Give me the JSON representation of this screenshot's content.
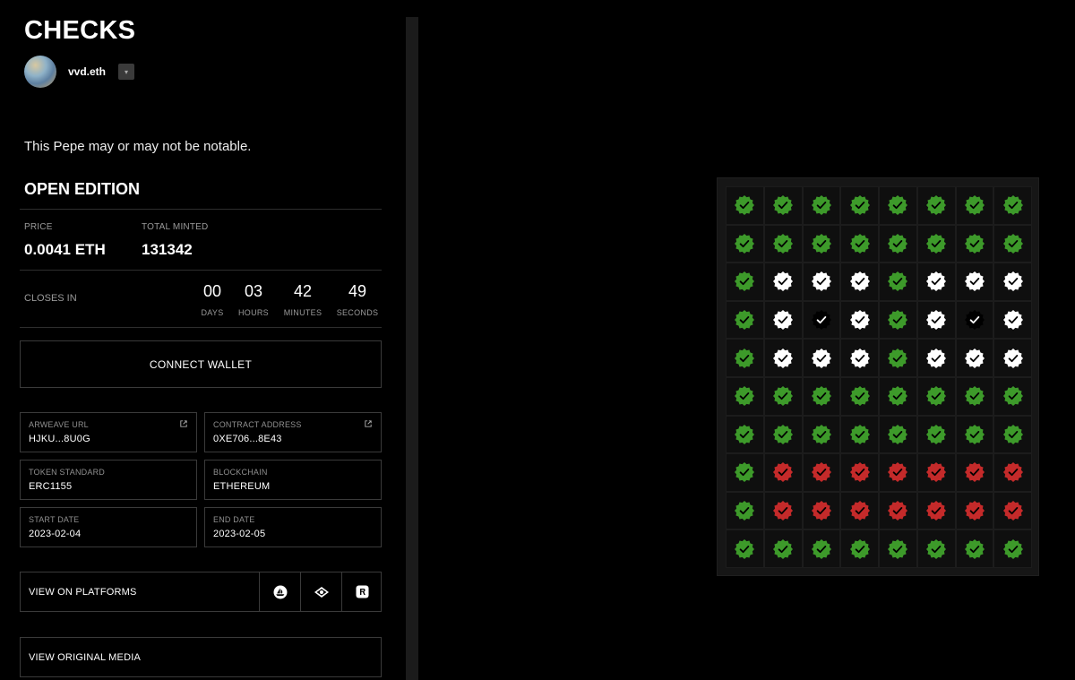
{
  "header": {
    "title": "CHECKS",
    "username": "vvd.eth"
  },
  "description": "This Pepe may or may not be notable.",
  "edition": "OPEN EDITION",
  "stats": {
    "price_label": "PRICE",
    "price_value": "0.0041 ETH",
    "minted_label": "TOTAL MINTED",
    "minted_value": "131342"
  },
  "countdown": {
    "label": "CLOSES IN",
    "units": [
      {
        "value": "00",
        "unit": "DAYS"
      },
      {
        "value": "03",
        "unit": "HOURS"
      },
      {
        "value": "42",
        "unit": "MINUTES"
      },
      {
        "value": "49",
        "unit": "SECONDS"
      }
    ]
  },
  "connect_label": "CONNECT WALLET",
  "details": [
    {
      "label": "ARWEAVE URL",
      "value": "HJKU...8U0G",
      "external": true
    },
    {
      "label": "CONTRACT ADDRESS",
      "value": "0XE706...8E43",
      "external": true
    },
    {
      "label": "TOKEN STANDARD",
      "value": "ERC1155",
      "external": false
    },
    {
      "label": "BLOCKCHAIN",
      "value": "ETHEREUM",
      "external": false
    },
    {
      "label": "START DATE",
      "value": "2023-02-04",
      "external": false
    },
    {
      "label": "END DATE",
      "value": "2023-02-05",
      "external": false
    }
  ],
  "platforms_label": "VIEW ON PLATFORMS",
  "platform_icons": [
    "opensea-icon",
    "eye-icon",
    "rarible-icon"
  ],
  "media_label": "VIEW ORIGINAL MEDIA",
  "colors": {
    "green": "#3d9a2a",
    "white": "#ffffff",
    "black": "#000000",
    "red": "#c42a2a"
  },
  "check_grid": [
    [
      "g",
      "g",
      "g",
      "g",
      "g",
      "g",
      "g",
      "g"
    ],
    [
      "g",
      "g",
      "g",
      "g",
      "g",
      "g",
      "g",
      "g"
    ],
    [
      "g",
      "w",
      "w",
      "w",
      "g",
      "w",
      "w",
      "w"
    ],
    [
      "g",
      "w",
      "b",
      "w",
      "g",
      "w",
      "b",
      "w"
    ],
    [
      "g",
      "w",
      "w",
      "w",
      "g",
      "w",
      "w",
      "w"
    ],
    [
      "g",
      "g",
      "g",
      "g",
      "g",
      "g",
      "g",
      "g"
    ],
    [
      "g",
      "g",
      "g",
      "g",
      "g",
      "g",
      "g",
      "g"
    ],
    [
      "g",
      "r",
      "r",
      "r",
      "r",
      "r",
      "r",
      "r"
    ],
    [
      "g",
      "r",
      "r",
      "r",
      "r",
      "r",
      "r",
      "r"
    ],
    [
      "g",
      "g",
      "g",
      "g",
      "g",
      "g",
      "g",
      "g"
    ]
  ]
}
